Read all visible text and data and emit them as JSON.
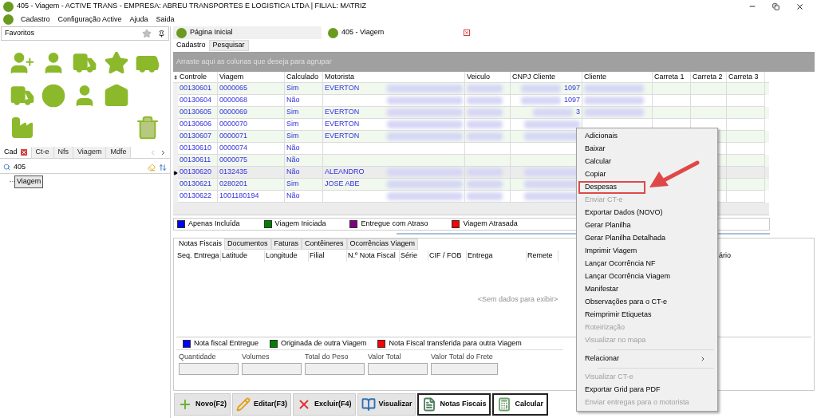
{
  "window": {
    "title": "405 - Viagem - ACTIVE TRANS - EMPRESA: ABREU TRANSPORTES E LOGISTICA LTDA | FILIAL: MATRIZ"
  },
  "menu": [
    "Cadastro",
    "Configuração Active",
    "Ajuda",
    "Saida"
  ],
  "left_panel": {
    "title": "Favoritos",
    "tabs": [
      {
        "label": "Cad",
        "selected": true
      },
      {
        "label": "Ct-e",
        "selected": false
      },
      {
        "label": "Nfs",
        "selected": false
      },
      {
        "label": "Viagem",
        "selected": false
      },
      {
        "label": "Mdfe",
        "selected": false
      }
    ],
    "search": {
      "value": "405"
    },
    "tree": [
      {
        "label": "Viagem",
        "selected": true
      }
    ]
  },
  "doc_tabs": [
    {
      "label": "Página Inicial",
      "selected": false,
      "closable": false
    },
    {
      "label": "405 - Viagem",
      "selected": true,
      "closable": true
    }
  ],
  "sub_tabs": [
    {
      "label": "Cadastro",
      "selected": true
    },
    {
      "label": "Pesquisar",
      "selected": false
    }
  ],
  "group_hint": "Arraste aqui as colunas que deseja para agrupar",
  "grid": {
    "columns": [
      "Controle",
      "Viagem",
      "Calculado",
      "Motorista",
      "Veiculo",
      "CNPJ Cliente",
      "Cliente",
      "Carreta 1",
      "Carreta 2",
      "Carreta 3"
    ],
    "rows": [
      {
        "controle": "00130601",
        "viagem": "0000065",
        "calculado": "Sim",
        "motorista": "EVERTON",
        "cnpj": "1097",
        "current": false,
        "redacted": true
      },
      {
        "controle": "00130604",
        "viagem": "0000068",
        "calculado": "Não",
        "cnpj": "1097",
        "current": false,
        "redacted": true
      },
      {
        "controle": "00130605",
        "viagem": "0000069",
        "calculado": "Sim",
        "motorista": "EVERTON",
        "cnpj": "3",
        "current": false,
        "redacted": true
      },
      {
        "controle": "00130606",
        "viagem": "0000070",
        "calculado": "Sim",
        "motorista": "EVERTON",
        "current": false,
        "redacted": true
      },
      {
        "controle": "00130607",
        "viagem": "0000071",
        "calculado": "Sim",
        "motorista": "EVERTON",
        "current": false,
        "redacted": true
      },
      {
        "controle": "00130610",
        "viagem": "0000074",
        "calculado": "Não",
        "current": false,
        "redacted": false
      },
      {
        "controle": "00130611",
        "viagem": "0000075",
        "calculado": "Não",
        "current": false,
        "redacted": false
      },
      {
        "controle": "00130620",
        "viagem": "0132435",
        "calculado": "Não",
        "motorista": "ALEANDRO",
        "current": true,
        "redacted": true
      },
      {
        "controle": "00130621",
        "viagem": "0280201",
        "calculado": "Sim",
        "motorista": "JOSE ABE",
        "current": false,
        "redacted": true
      },
      {
        "controle": "00130622",
        "viagem": "1001180194",
        "calculado": "Não",
        "current": false,
        "redacted": true
      }
    ]
  },
  "legend": [
    {
      "label": "Apenas Incluída",
      "color": "#0000ff"
    },
    {
      "label": "Viagem Iniciada",
      "color": "#008000"
    },
    {
      "label": "Entregue com Atraso",
      "color": "#800080"
    },
    {
      "label": "Viagem Atrasada",
      "color": "#ff0000"
    }
  ],
  "detail_tabs": [
    {
      "label": "Notas Fiscais",
      "selected": true
    },
    {
      "label": "Documentos",
      "selected": false
    },
    {
      "label": "Faturas",
      "selected": false
    },
    {
      "label": "Contêineres",
      "selected": false
    },
    {
      "label": "Ocorrências Viagem",
      "selected": false
    }
  ],
  "detail_columns": [
    "Seq. Entrega",
    "Latitude",
    "Longitude",
    "Filial",
    "N.º Nota Fiscal",
    "Série",
    "CIF / FOB",
    "Entrega",
    "Remete",
    "ário"
  ],
  "empty_text": "<Sem dados para exibir>",
  "nf_legend": [
    {
      "label": "Nota fiscal Entregue",
      "color": "#0000ff"
    },
    {
      "label": "Originada de outra Viagem",
      "color": "#008000"
    },
    {
      "label": "Nota Fiscal transferida para outra Viagem",
      "color": "#ff0000"
    }
  ],
  "totals": [
    "Quantidade",
    "Volumes",
    "Total do Peso",
    "Valor Total",
    "Valor Total do Frete"
  ],
  "buttons": [
    {
      "label": "Novo(F2)",
      "kind": "new",
      "highlighted": false
    },
    {
      "label": "Editar(F3)",
      "kind": "edit",
      "highlighted": false
    },
    {
      "label": "Excluir(F4)",
      "kind": "delete",
      "highlighted": false
    },
    {
      "label": "Visualizar",
      "kind": "view",
      "highlighted": false
    },
    {
      "label": "Notas Fiscais",
      "kind": "invoices",
      "highlighted": true
    },
    {
      "label": "Calcular",
      "kind": "calculate",
      "highlighted": true
    }
  ],
  "context_menu": [
    {
      "kind": "item",
      "label": "Adicionais",
      "disabled": false,
      "highlighted": false
    },
    {
      "kind": "item",
      "label": "Baixar",
      "disabled": false,
      "highlighted": false
    },
    {
      "kind": "item",
      "label": "Calcular",
      "disabled": false,
      "highlighted": false
    },
    {
      "kind": "item",
      "label": "Copiar",
      "disabled": false,
      "highlighted": false
    },
    {
      "kind": "item",
      "label": "Despesas",
      "disabled": false,
      "highlighted": true
    },
    {
      "kind": "item",
      "label": "Enviar CT-e",
      "disabled": true,
      "highlighted": false
    },
    {
      "kind": "item",
      "label": "Exportar Dados (NOVO)",
      "disabled": false,
      "highlighted": false
    },
    {
      "kind": "item",
      "label": "Gerar Planilha",
      "disabled": false,
      "highlighted": false
    },
    {
      "kind": "item",
      "label": "Gerar Planilha Detalhada",
      "disabled": false,
      "highlighted": false
    },
    {
      "kind": "item",
      "label": "Imprimir Viagem",
      "disabled": false,
      "highlighted": false
    },
    {
      "kind": "item",
      "label": "Lançar Ocorrência NF",
      "disabled": false,
      "highlighted": false
    },
    {
      "kind": "item",
      "label": "Lançar Ocorrência Viagem",
      "disabled": false,
      "highlighted": false
    },
    {
      "kind": "item",
      "label": "Manifestar",
      "disabled": false,
      "highlighted": false
    },
    {
      "kind": "item",
      "label": "Observações para o CT-e",
      "disabled": false,
      "highlighted": false
    },
    {
      "kind": "item",
      "label": "Reimprimir Etiquetas",
      "disabled": false,
      "highlighted": false
    },
    {
      "kind": "item",
      "label": "Roteirização",
      "disabled": true,
      "highlighted": false
    },
    {
      "kind": "item",
      "label": "Visualizar no mapa",
      "disabled": true,
      "highlighted": false
    },
    {
      "kind": "separator"
    },
    {
      "kind": "submenu",
      "label": "Relacionar",
      "disabled": false,
      "highlighted": false
    },
    {
      "kind": "separator"
    },
    {
      "kind": "item",
      "label": "Visualizar CT-e",
      "disabled": true,
      "highlighted": false
    },
    {
      "kind": "item",
      "label": "Exportar Grid para PDF",
      "disabled": false,
      "highlighted": false
    },
    {
      "kind": "item",
      "label": "Enviar entregas para o motorista",
      "disabled": true,
      "highlighted": false
    }
  ]
}
